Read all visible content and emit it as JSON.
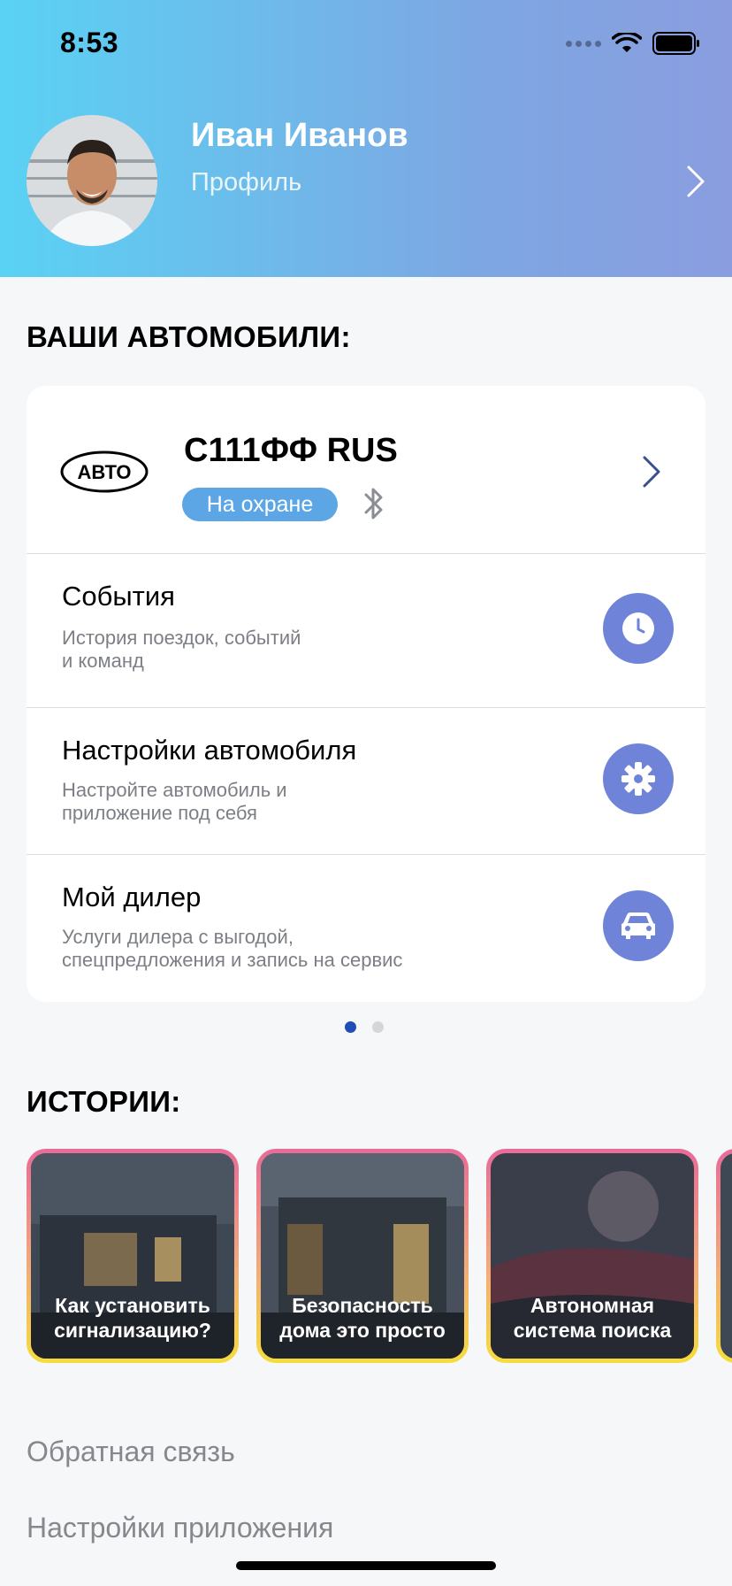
{
  "status_bar": {
    "time": "8:53"
  },
  "profile": {
    "name": "Иван Иванов",
    "subtitle": "Профиль"
  },
  "cars_section": {
    "title": "ВАШИ АВТОМОБИЛИ:"
  },
  "car": {
    "logo_text": "АВТО",
    "plate": "С111ФФ RUS",
    "status": "На охране"
  },
  "menu": [
    {
      "title": "События",
      "desc1": "История поездок, событий",
      "desc2": "и команд",
      "icon": "clock-icon"
    },
    {
      "title": "Настройки автомобиля",
      "desc1": "Настройте автомобиль и",
      "desc2": "приложение под себя",
      "icon": "gear-icon"
    },
    {
      "title": "Мой дилер",
      "desc1": "Услуги дилера с выгодой,",
      "desc2": "спецпредложения и запись на сервис",
      "icon": "car-icon"
    }
  ],
  "pager": {
    "count": 2,
    "active": 0
  },
  "stories_section": {
    "title": "ИСТОРИИ:"
  },
  "stories": [
    {
      "line1": "Как установить",
      "line2": "сигнализацию?"
    },
    {
      "line1": "Безопасность",
      "line2": "дома это просто"
    },
    {
      "line1": "Автономная",
      "line2": "система поиска"
    }
  ],
  "links": {
    "feedback": "Обратная связь",
    "app_settings": "Настройки приложения"
  },
  "colors": {
    "accent": "#6f83d8",
    "badge": "#5ca6e6",
    "pager_active": "#1f4fb4",
    "pager_inactive": "#d5d6d9"
  }
}
